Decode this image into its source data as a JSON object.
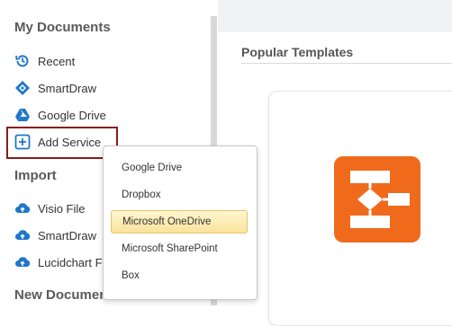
{
  "sidebar": {
    "my_documents_title": "My Documents",
    "documents": [
      {
        "label": "Recent",
        "icon": "history-icon"
      },
      {
        "label": "SmartDraw",
        "icon": "smartdraw-icon"
      },
      {
        "label": "Google Drive",
        "icon": "google-drive-icon"
      },
      {
        "label": "Add Service",
        "icon": "plus-square-icon"
      }
    ],
    "import_title": "Import",
    "imports": [
      {
        "label": "Visio File",
        "icon": "cloud-upload-icon"
      },
      {
        "label": "SmartDraw",
        "icon": "cloud-upload-icon"
      },
      {
        "label": "Lucidchart F",
        "icon": "cloud-upload-icon"
      }
    ],
    "new_document_title": "New Document"
  },
  "main": {
    "templates_title": "Popular Templates"
  },
  "dropdown": {
    "options": [
      "Google Drive",
      "Dropbox",
      "Microsoft OneDrive",
      "Microsoft SharePoint",
      "Box"
    ],
    "selected": "Microsoft OneDrive"
  },
  "colors": {
    "accent_blue": "#1f77c8",
    "highlight_border": "#8b1a1a",
    "template_orange": "#f06a1c"
  }
}
